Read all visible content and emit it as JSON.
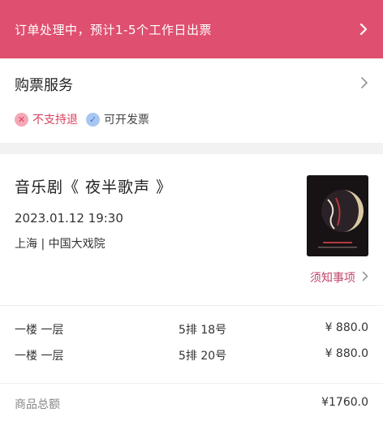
{
  "banner": {
    "text": "订单处理中，预计1-5个工作日出票",
    "chevron_icon": "chevron-right-icon"
  },
  "service": {
    "title": "购票服务",
    "tags": [
      {
        "label": "不支持退",
        "icon": "cross-circle-icon",
        "color": "#d9415e"
      },
      {
        "label": "可开发票",
        "icon": "check-circle-icon",
        "color": "#3f74d6"
      }
    ]
  },
  "show": {
    "title": "音乐剧《 夜半歌声 》",
    "datetime": "2023.01.12  19:30",
    "venue": "上海  |  中国大戏院",
    "notice_label": "须知事项"
  },
  "tickets": [
    {
      "area": "一楼 一层",
      "seat": "5排 18号",
      "price": "¥ 880.0"
    },
    {
      "area": "一楼 一层",
      "seat": "5排 20号",
      "price": "¥ 880.0"
    }
  ],
  "total": {
    "label": "商品总额",
    "value": "¥1760.0"
  },
  "colors": {
    "banner": "#df4f6f",
    "accent": "#c2446a"
  }
}
